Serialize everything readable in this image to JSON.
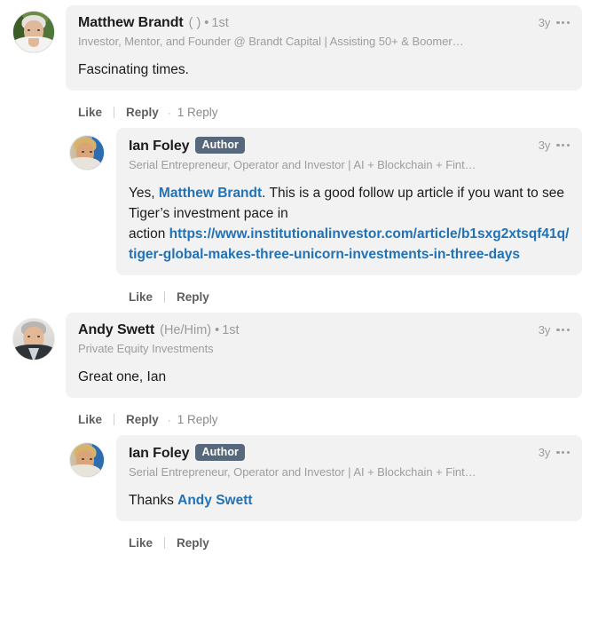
{
  "thread": {
    "comments": [
      {
        "id": "comment-matthew-brandt",
        "avatar_style": "av-mb",
        "avatar_alt": "matthew-brandt-avatar",
        "name": "Matthew Brandt",
        "pronouns": "( )",
        "separator": "•",
        "degree": "1st",
        "badge": "",
        "headline": "Investor, Mentor, and Founder @ Brandt Capital | Assisting 50+ & Boomer…",
        "age": "3y",
        "body_parts": [
          {
            "type": "text",
            "value": "Fascinating times."
          }
        ],
        "actions": {
          "like": "Like",
          "reply": "Reply",
          "dot": "·",
          "reply_count": "1 Reply"
        }
      },
      {
        "id": "comment-ian-foley-1",
        "avatar_style": "av-if",
        "avatar_alt": "ian-foley-avatar",
        "name": "Ian Foley",
        "pronouns": "",
        "separator": "",
        "degree": "",
        "badge": "Author",
        "headline": "Serial Entrepreneur, Operator and Investor | AI + Blockchain + Fint…",
        "age": "3y",
        "body_parts": [
          {
            "type": "text",
            "value": "Yes, "
          },
          {
            "type": "mention",
            "value": "Matthew Brandt"
          },
          {
            "type": "text",
            "value": ". This is a good follow up article if you want to see Tiger’s investment pace in\naction "
          },
          {
            "type": "link",
            "value": "https://www.institutionalinvestor.com/article/b1sxg2xtsqf41q/tiger-global-makes-three-unicorn-investments-in-three-days"
          }
        ],
        "actions": {
          "like": "Like",
          "reply": "Reply",
          "dot": "",
          "reply_count": ""
        }
      },
      {
        "id": "comment-andy-swett",
        "avatar_style": "av-as",
        "avatar_alt": "andy-swett-avatar",
        "name": "Andy Swett",
        "pronouns": "(He/Him)",
        "separator": "•",
        "degree": "1st",
        "badge": "",
        "headline": "Private Equity Investments",
        "age": "3y",
        "body_parts": [
          {
            "type": "text",
            "value": "Great one, Ian"
          }
        ],
        "actions": {
          "like": "Like",
          "reply": "Reply",
          "dot": "·",
          "reply_count": "1 Reply"
        }
      },
      {
        "id": "comment-ian-foley-2",
        "avatar_style": "av-if",
        "avatar_alt": "ian-foley-avatar",
        "name": "Ian Foley",
        "pronouns": "",
        "separator": "",
        "degree": "",
        "badge": "Author",
        "headline": "Serial Entrepreneur, Operator and Investor | AI + Blockchain + Fint…",
        "age": "3y",
        "body_parts": [
          {
            "type": "text",
            "value": "Thanks "
          },
          {
            "type": "mention",
            "value": "Andy Swett"
          }
        ],
        "actions": {
          "like": "Like",
          "reply": "Reply",
          "dot": "",
          "reply_count": ""
        }
      }
    ],
    "nesting": [
      false,
      true,
      false,
      true
    ],
    "icons": {
      "more": "more-options-icon"
    },
    "colors": {
      "link": "#2272b5",
      "mention": "#2272b5",
      "bubble_bg": "#f2f2f2",
      "author_badge_bg": "#56687c",
      "page_bg": "#ffffff",
      "muted_text": "#9d9d9d",
      "action_text": "#5e5e5e"
    }
  }
}
